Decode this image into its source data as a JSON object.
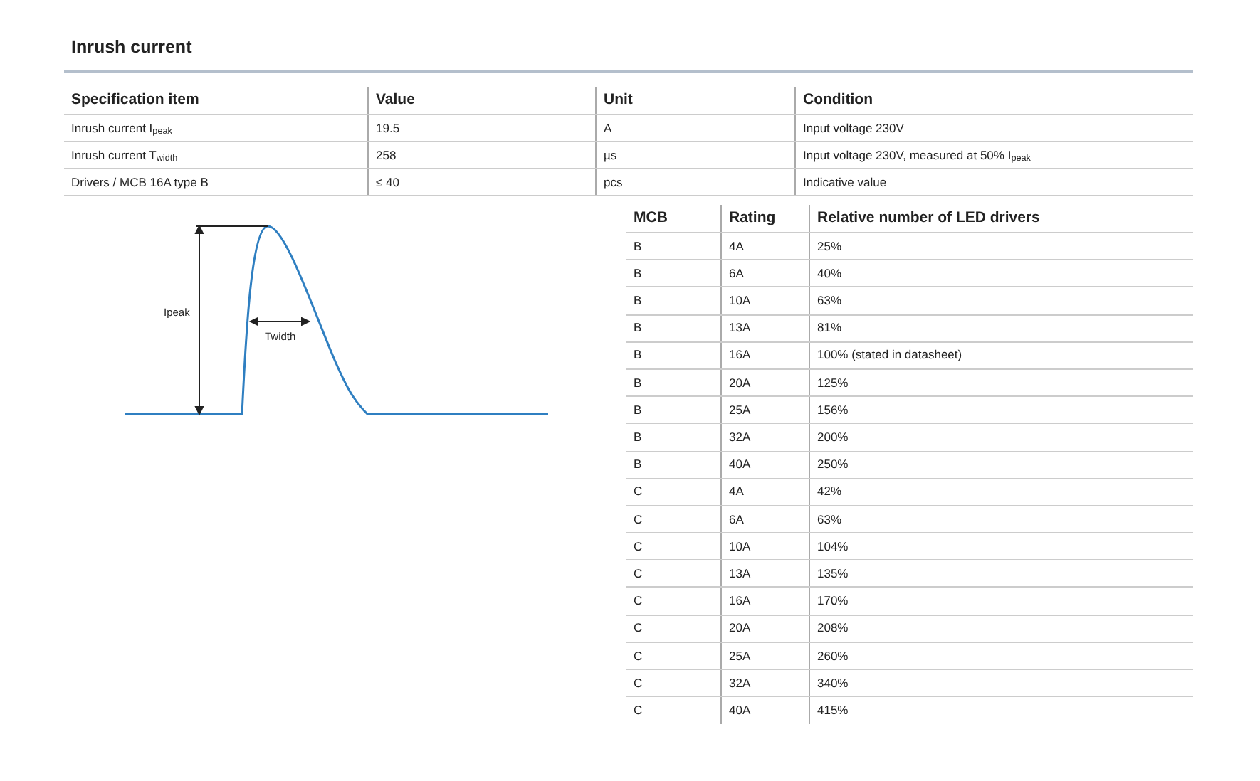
{
  "title": "Inrush current",
  "spec_table": {
    "columns": [
      "Specification item",
      "Value",
      "Unit",
      "Condition"
    ],
    "rows": [
      [
        "Inrush current I$_{peak}$",
        "19.5",
        "A",
        "Input voltage 230V"
      ],
      [
        "Inrush current T$_{width}$",
        "258",
        "µs",
        "Input voltage 230V, measured at 50% I$_{peak}$"
      ],
      [
        "Drivers / MCB 16A type B",
        "≤ 40",
        "pcs",
        "Indicative value"
      ]
    ]
  },
  "diagram": {
    "peak_label": "Ipeak",
    "width_label": "Twidth"
  },
  "mcb_table": {
    "columns": [
      "MCB",
      "Rating",
      "Relative number of LED drivers"
    ],
    "rows": [
      [
        "B",
        "4A",
        "25%"
      ],
      [
        "B",
        "6A",
        "40%"
      ],
      [
        "B",
        "10A",
        "63%"
      ],
      [
        "B",
        "13A",
        "81%"
      ],
      [
        "B",
        "16A",
        "100% (stated in datasheet)"
      ],
      [
        "B",
        "20A",
        "125%"
      ],
      [
        "B",
        "25A",
        "156%"
      ],
      [
        "B",
        "32A",
        "200%"
      ],
      [
        "B",
        "40A",
        "250%"
      ],
      [
        "C",
        "4A",
        "42%"
      ],
      [
        "C",
        "6A",
        "63%"
      ],
      [
        "C",
        "10A",
        "104%"
      ],
      [
        "C",
        "13A",
        "135%"
      ],
      [
        "C",
        "16A",
        "170%"
      ],
      [
        "C",
        "20A",
        "208%"
      ],
      [
        "C",
        "25A",
        "260%"
      ],
      [
        "C",
        "32A",
        "340%"
      ],
      [
        "C",
        "40A",
        "415%"
      ]
    ]
  }
}
